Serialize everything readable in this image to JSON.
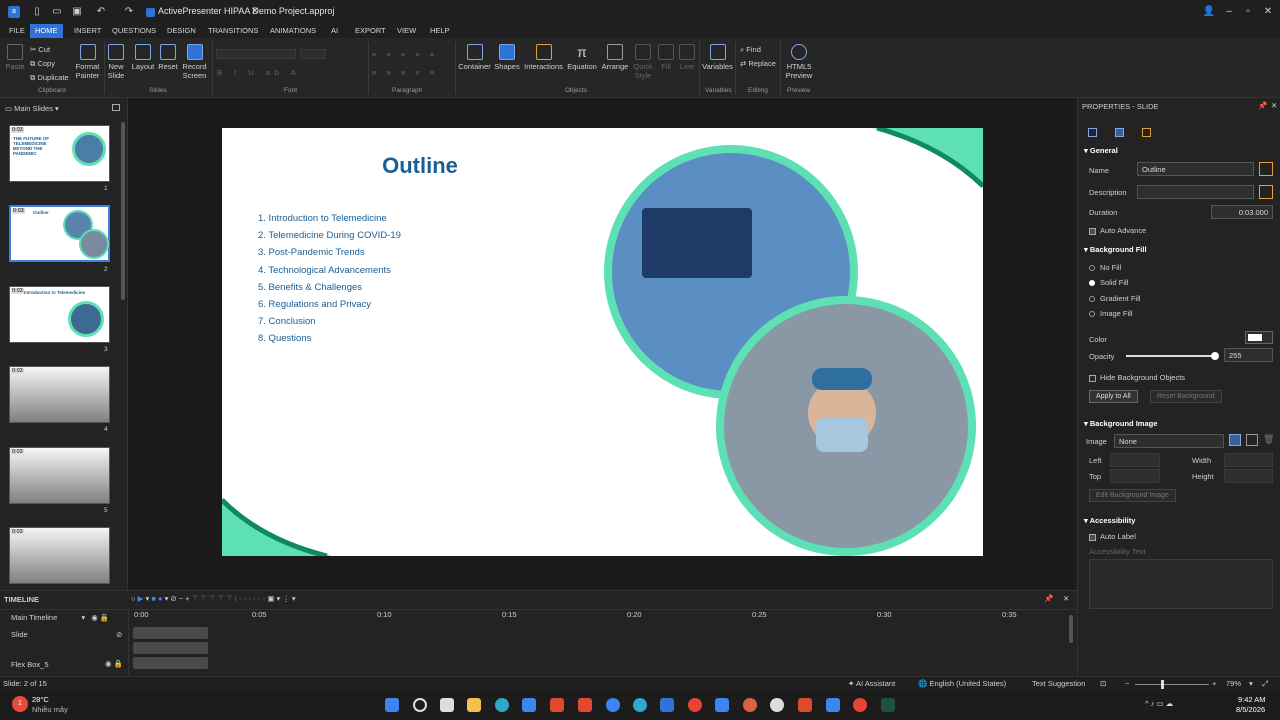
{
  "window": {
    "title": "ActivePresenter HIPAA Demo Project.approj"
  },
  "menu": [
    "FILE",
    "HOME",
    "INSERT",
    "QUESTIONS",
    "DESIGN",
    "TRANSITIONS",
    "ANIMATIONS",
    "AI",
    "EXPORT",
    "VIEW",
    "HELP"
  ],
  "ribbon": {
    "paste": "Paste",
    "cut": "Cut",
    "copy": "Copy",
    "duplicate": "Duplicate",
    "format_painter": "Format\nPainter",
    "new_slide": "New\nSlide",
    "layout": "Layout",
    "reset": "Reset",
    "record_screen": "Record\nScreen",
    "container": "Container",
    "shapes": "Shapes",
    "interactions": "Interactions",
    "equation": "Equation",
    "arrange": "Arrange",
    "quick_style": "Quick\nStyle",
    "fill": "Fill",
    "line": "Line",
    "variables": "Variables",
    "find": "Find",
    "replace": "Replace",
    "html5_preview": "HTML5\nPreview",
    "groups": {
      "clipboard": "Clipboard",
      "slides": "Slides",
      "font": "Font",
      "paragraph": "Paragraph",
      "objects": "Objects",
      "variables": "Variables",
      "editing": "Editing",
      "preview": "Preview"
    }
  },
  "left_panel": {
    "header": "Main Slides",
    "thumbs": [
      {
        "num": "1",
        "time": "0:03",
        "title": "THE FUTURE OF TELEMEDICINE BEYOND THE PANDEMIC"
      },
      {
        "num": "2",
        "time": "0:03",
        "title": "Outline"
      },
      {
        "num": "3",
        "time": "0:03",
        "title": "Introduction to Telemedicine"
      },
      {
        "num": "4",
        "time": "0:03",
        "title": ""
      },
      {
        "num": "5",
        "time": "0:03",
        "title": ""
      },
      {
        "num": "",
        "time": "0:03",
        "title": ""
      }
    ]
  },
  "slide": {
    "title": "Outline",
    "items": [
      "1. Introduction to Telemedicine",
      "2. Telemedicine During COVID-19",
      "3. Post-Pandemic Trends",
      "4. Technological Advancements",
      "5. Benefits & Challenges",
      "6. Regulations and Privacy",
      "7. Conclusion",
      "8. Questions"
    ],
    "colors": {
      "title": "#1a5e94",
      "text": "#1a5e94",
      "accent": "#5ee0b5",
      "accent_dark": "#0f8a5c"
    }
  },
  "properties": {
    "header": "PROPERTIES - SLIDE",
    "general": "General",
    "name_label": "Name",
    "name_value": "Outline",
    "description_label": "Description",
    "description_value": "",
    "duration_label": "Duration",
    "duration_value": "0:03.000",
    "auto_advance": "Auto Advance",
    "background_fill": "Background Fill",
    "no_fill": "No Fill",
    "solid_fill": "Solid Fill",
    "gradient_fill": "Gradient Fill",
    "image_fill": "Image Fill",
    "color_label": "Color",
    "opacity_label": "Opacity",
    "opacity_value": "255",
    "opacity_fraction": 1.0,
    "hide_bg_objects": "Hide Background Objects",
    "apply_all": "Apply to All",
    "reset_bg": "Reset Background",
    "background_image": "Background Image",
    "image_label": "Image",
    "image_value": "None",
    "left_label": "Left",
    "width_label": "Width",
    "top_label": "Top",
    "height_label": "Height",
    "edit_bg_image": "Edit Background Image",
    "accessibility": "Accessibility",
    "auto_label": "Auto Label",
    "accessibility_text": "Accessibility Text"
  },
  "timeline": {
    "header": "TIMELINE",
    "main_timeline": "Main Timeline",
    "rows": [
      "Slide",
      "Flex Box_5"
    ],
    "ticks": [
      "0:00",
      "0:05",
      "0:10",
      "0:15",
      "0:20",
      "0:25",
      "0:30",
      "0:35"
    ]
  },
  "status": {
    "slide": "Slide: 2 of 15",
    "ai": "AI Assistant",
    "language": "English (United States)",
    "text_suggestion": "Text Suggestion",
    "zoom": "79%"
  },
  "taskbar": {
    "temp": "28°C",
    "weather": "Nhiều mây",
    "time": "9:42 AM",
    "date": "8/5/2026"
  }
}
